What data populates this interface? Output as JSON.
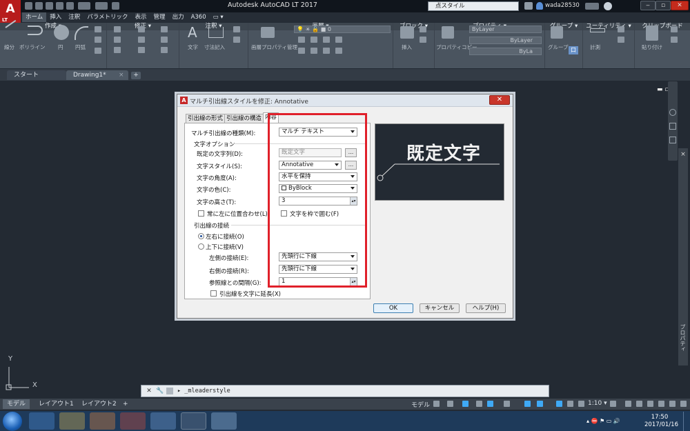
{
  "app": {
    "logo": "A",
    "logo_sub": "LT",
    "title": "Autodesk AutoCAD LT 2017",
    "search_placeholder": "点スタイル",
    "user": "wada28530",
    "ribbon_tabs": [
      "ホーム",
      "挿入",
      "注釈",
      "パラメトリック",
      "表示",
      "管理",
      "出力",
      "A360",
      "▭ ▾"
    ],
    "active_ribbon_tab": "ホーム",
    "panels": [
      "作成 ▾",
      "修正 ▾",
      "注釈 ▾",
      "画層 ▾",
      "ブロック ▾",
      "プロパティ ▾",
      "グループ ▾",
      "ユーティリティ ▾",
      "クリップボード"
    ],
    "tool_labels": [
      "線分",
      "ポリライン",
      "円",
      "円弧",
      "文字",
      "寸法記入",
      "画層プロパティ管理",
      "挿入",
      "プロパティコピー",
      "グループ",
      "計測",
      "貼り付け"
    ],
    "layer_value": "0",
    "prop_bylayer_1": "ByLayer",
    "prop_bylayer_2": "ByLayer",
    "prop_bylayer_3": "ByLa",
    "group_extra": "口"
  },
  "doc_tabs": {
    "start": "スタート",
    "drawing": "Drawing1*",
    "close": "×",
    "add": "+"
  },
  "viewport": {
    "controls": "▬ ▫ ×",
    "palette_label": "プロパティ",
    "ucs_y": "Y",
    "ucs_x": "X"
  },
  "dialog": {
    "title": "マルチ引出線スタイルを修正: Annotative",
    "close_glyph": "✕",
    "tabs": [
      "引出線の形式",
      "引出線の構造",
      "内容"
    ],
    "active_tab": "内容",
    "leader_type_label": "マルチ引出線の種類(M):",
    "leader_type_value": "マルチ テキスト",
    "text_options_title": "文字オプション",
    "default_text_label": "既定の文字列(D):",
    "default_text_value": "既定文字",
    "ellipsis": "...",
    "text_style_label": "文字スタイル(S):",
    "text_style_value": "Annotative",
    "text_angle_label": "文字の角度(A):",
    "text_angle_value": "水平を保持",
    "text_color_label": "文字の色(C):",
    "text_color_value": "ByBlock",
    "text_height_label": "文字の高さ(T):",
    "text_height_value": "3",
    "always_left_label": "常に左に位置合わせ(L)",
    "frame_text_label": "文字を枠で囲む(F)",
    "connection_title": "引出線の接続",
    "horizontal_label": "左右に接続(O)",
    "vertical_label": "上下に接続(V)",
    "left_attach_label": "左側の接続(E):",
    "left_attach_value": "先頭行に下線",
    "right_attach_label": "右側の接続(R):",
    "right_attach_value": "先頭行に下線",
    "landing_gap_label": "参照線との間隔(G):",
    "landing_gap_value": "1",
    "extend_leader_label": "引出線を文字に延長(X)",
    "preview_text": "既定文字",
    "ok": "OK",
    "cancel": "キャンセル",
    "help": "ヘルプ(H)"
  },
  "command_line": {
    "text": "▸ _mleaderstyle"
  },
  "layout_tabs": [
    "モデル",
    "レイアウト1",
    "レイアウト2",
    "+"
  ],
  "status": {
    "model": "モデル",
    "scale": "1:10 ▾"
  },
  "taskbar": {
    "time": "17:50",
    "date": "2017/01/16"
  },
  "colors": {
    "accent_red": "#e0202a",
    "canvas": "#232a33",
    "ribbon": "#4a545f"
  }
}
